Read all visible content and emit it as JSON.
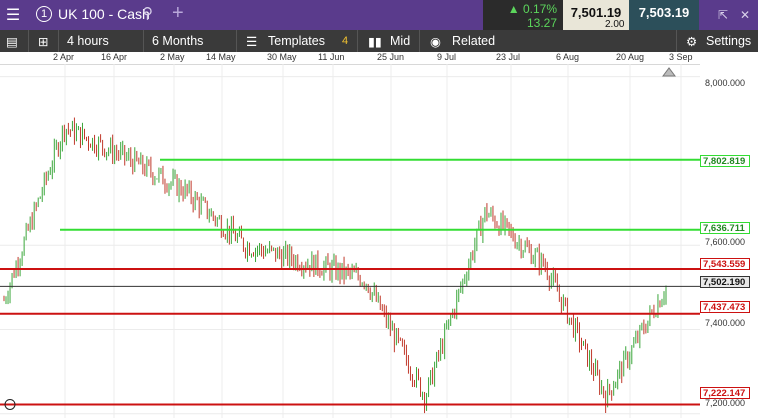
{
  "topbar": {
    "menu_icon": "hamburger-icon",
    "tab_number": "1",
    "instrument": "UK 100 - Cash",
    "change_pct": "▲ 0.17%",
    "change_pts": "13.27",
    "sell_price": "7,501.19",
    "buy_price": "7,503.19",
    "spread": "2.00"
  },
  "toolbar": {
    "interval": "4 hours",
    "range": "6 Months",
    "templates": "Templates",
    "templates_count": "4",
    "price_type": "Mid",
    "related": "Related",
    "settings": "Settings"
  },
  "time_axis": [
    "2 Apr",
    "16 Apr",
    "2 May",
    "14 May",
    "30 May",
    "11 Jun",
    "25 Jun",
    "9 Jul",
    "23 Jul",
    "6 Aug",
    "20 Aug",
    "3 Sep"
  ],
  "price_axis": [
    "8,000.000",
    "7,600.000",
    "7,400.000",
    "7,200.000"
  ],
  "price_tags": {
    "green1": "7,802.819",
    "green2": "7,636.711",
    "red1": "7,543.559",
    "current": "7,502.190",
    "red2": "7,437.473",
    "red3": "7,222.147"
  },
  "colors": {
    "accent": "#5a3b8c",
    "up": "#3aa63a",
    "down": "#c0392b",
    "support_line": "#33dd33",
    "resistance_line": "#cc1111"
  },
  "chart_data": {
    "type": "line",
    "title": "",
    "xlabel": "",
    "ylabel": "",
    "ylim": [
      7190,
      8030
    ],
    "x": [
      "2 Apr",
      "16 Apr",
      "2 May",
      "14 May",
      "30 May",
      "11 Jun",
      "25 Jun",
      "9 Jul",
      "23 Jul",
      "6 Aug",
      "20 Aug",
      "3 Sep"
    ],
    "series": [
      {
        "values": [
          7470,
          7880,
          7810,
          7730,
          7600,
          7560,
          7520,
          7240,
          7680,
          7550,
          7240,
          7500
        ]
      }
    ],
    "horizontal_levels": [
      7802.819,
      7636.711,
      7543.559,
      7502.19,
      7437.473,
      7222.147
    ]
  }
}
